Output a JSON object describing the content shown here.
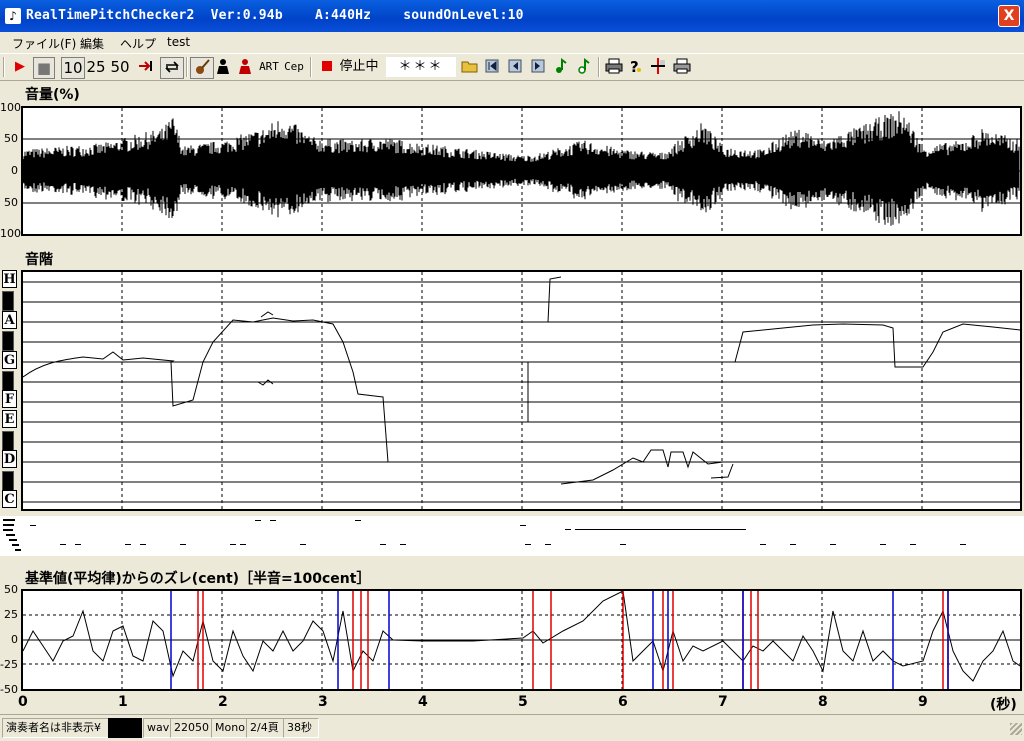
{
  "window": {
    "title": "RealTimePitchChecker2  Ver:0.94b    A:440Hz    soundOnLevel:10",
    "icon": "music-note-icon",
    "close_label": "X"
  },
  "menu": [
    "ファイル(F)",
    "編集",
    "ヘルプ",
    "test"
  ],
  "toolbar": {
    "record": "▶",
    "stop": "■",
    "n10": "10",
    "n25": "25",
    "n50": "50",
    "art": "ART",
    "cep": "Cep",
    "status_text": "停止中",
    "asterisks": "＊＊＊"
  },
  "volume_panel": {
    "title": "音量(%)",
    "yticks": [
      "100",
      "50",
      "0",
      "50",
      "100"
    ]
  },
  "pitch_panel": {
    "title": "音階",
    "notes": [
      "H",
      "A",
      "G",
      "F",
      "E",
      "D",
      "C"
    ]
  },
  "deviation_panel": {
    "title": "基準値(平均律)からのズレ(cent)［半音=100cent］",
    "yticks": [
      "50",
      "25",
      "0",
      "-25",
      "-50"
    ]
  },
  "xaxis": {
    "ticks": [
      "0",
      "1",
      "2",
      "3",
      "4",
      "5",
      "6",
      "7",
      "8",
      "9"
    ],
    "unit": "(秒)"
  },
  "statusbar": {
    "performer": "演奏者名は非表示¥",
    "ext": "wav",
    "rate": "22050",
    "channel": "Mono",
    "page": "2/4頁",
    "duration": "38秒"
  },
  "colors": {
    "title_bar": "#0a5fe0",
    "red_marker": "#e00000",
    "blue_marker": "#0000d0"
  }
}
